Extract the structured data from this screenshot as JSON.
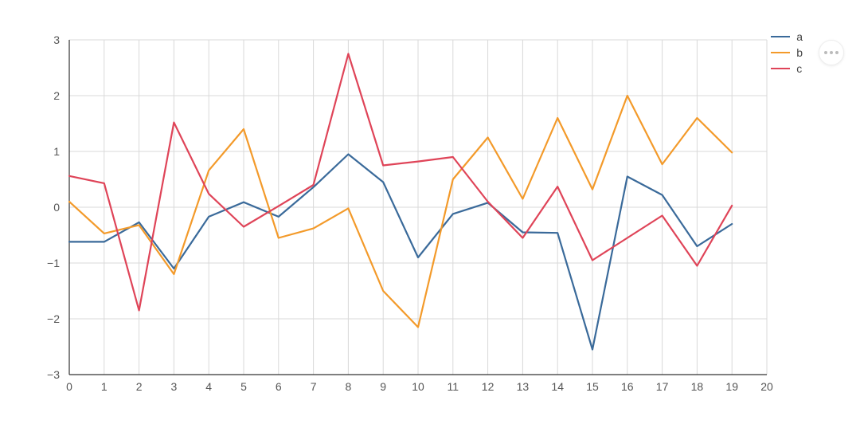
{
  "chart_data": {
    "type": "line",
    "x": [
      0,
      1,
      2,
      3,
      4,
      5,
      6,
      7,
      8,
      9,
      10,
      11,
      12,
      13,
      14,
      15,
      16,
      17,
      18,
      19
    ],
    "series": [
      {
        "name": "a",
        "color": "#3a6a9a",
        "values": [
          -0.62,
          -0.62,
          -0.27,
          -1.1,
          -0.17,
          0.09,
          -0.17,
          0.36,
          0.95,
          0.45,
          -0.9,
          -0.12,
          0.08,
          -0.45,
          -0.46,
          -2.55,
          0.55,
          0.22,
          -0.7,
          -0.3
        ]
      },
      {
        "name": "b",
        "color": "#f39a2a",
        "values": [
          0.1,
          -0.47,
          -0.32,
          -1.2,
          0.66,
          1.4,
          -0.55,
          -0.38,
          -0.02,
          -1.5,
          -2.15,
          0.5,
          1.25,
          0.15,
          1.6,
          0.32,
          2.0,
          0.77,
          1.6,
          0.98
        ]
      },
      {
        "name": "c",
        "color": "#df4458",
        "values": [
          0.56,
          0.43,
          -1.85,
          1.52,
          0.24,
          -0.35,
          0.02,
          0.4,
          2.75,
          0.75,
          0.82,
          0.9,
          0.1,
          -0.55,
          0.37,
          -0.95,
          -0.55,
          -0.15,
          -1.05,
          0.03
        ]
      }
    ],
    "xlim": [
      0,
      20
    ],
    "ylim": [
      -3,
      3
    ],
    "xticks": [
      0,
      1,
      2,
      3,
      4,
      5,
      6,
      7,
      8,
      9,
      10,
      11,
      12,
      13,
      14,
      15,
      16,
      17,
      18,
      19,
      20
    ],
    "yticks": [
      -3,
      -2,
      -1,
      0,
      1,
      2,
      3
    ],
    "title": "",
    "xlabel": "",
    "ylabel": ""
  },
  "legend": {
    "items": [
      "a",
      "b",
      "c"
    ]
  },
  "menu": {
    "label": "chart-options"
  }
}
